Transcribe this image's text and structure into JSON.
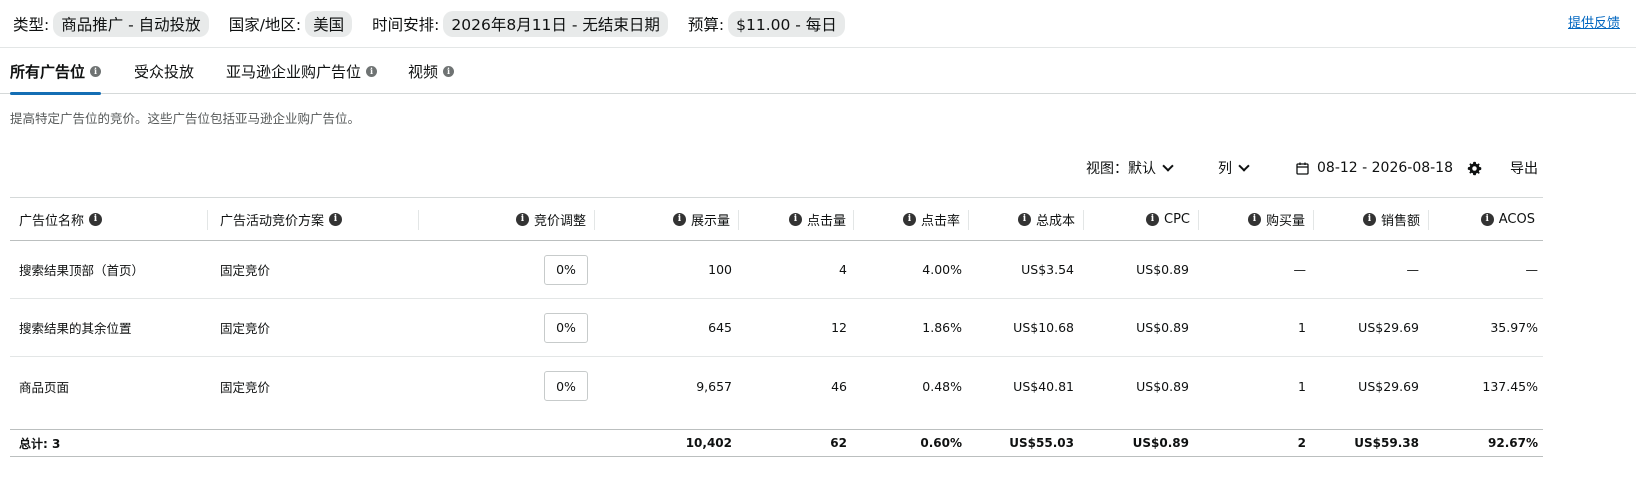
{
  "summary": {
    "type_label": "类型:",
    "type_value": "商品推广 - 自动投放",
    "country_label": "国家/地区:",
    "country_value": "美国",
    "schedule_label": "时间安排:",
    "schedule_value": "2026年8月11日 - 无结束日期",
    "budget_label": "预算:",
    "budget_value": "$11.00 - 每日",
    "feedback_link": "提供反馈"
  },
  "tabs": [
    {
      "label": "所有广告位",
      "active": true,
      "info": true
    },
    {
      "label": "受众投放",
      "active": false,
      "info": false
    },
    {
      "label": "亚马逊企业购广告位",
      "active": false,
      "info": true
    },
    {
      "label": "视频",
      "active": false,
      "info": true
    }
  ],
  "description": "提高特定广告位的竞价。这些广告位包括亚马逊企业购广告位。",
  "toolbar": {
    "view_label": "视图：默认",
    "columns_label": "列",
    "date_range": "08-12 - 2026-08-18",
    "export_label": "导出",
    "calendar_icon": "calendar-icon",
    "settings_icon": "gear-icon"
  },
  "table": {
    "headers": [
      "广告位名称",
      "广告活动竞价方案",
      "竞价调整",
      "展示量",
      "点击量",
      "点击率",
      "总成本",
      "CPC",
      "购买量",
      "销售额",
      "ACOS"
    ],
    "rows": [
      {
        "name": "搜索结果顶部（首页）",
        "strategy": "固定竞价",
        "bid": "0%",
        "impressions": "100",
        "clicks": "4",
        "ctr": "4.00%",
        "cost": "US$3.54",
        "cpc": "US$0.89",
        "purchases": "—",
        "sales": "—",
        "acos": "—"
      },
      {
        "name": "搜索结果的其余位置",
        "strategy": "固定竞价",
        "bid": "0%",
        "impressions": "645",
        "clicks": "12",
        "ctr": "1.86%",
        "cost": "US$10.68",
        "cpc": "US$0.89",
        "purchases": "1",
        "sales": "US$29.69",
        "acos": "35.97%"
      },
      {
        "name": "商品页面",
        "strategy": "固定竞价",
        "bid": "0%",
        "impressions": "9,657",
        "clicks": "46",
        "ctr": "0.48%",
        "cost": "US$40.81",
        "cpc": "US$0.89",
        "purchases": "1",
        "sales": "US$29.69",
        "acos": "137.45%"
      }
    ],
    "total": {
      "label": "总计: 3",
      "impressions": "10,402",
      "clicks": "62",
      "ctr": "0.60%",
      "cost": "US$55.03",
      "cpc": "US$0.89",
      "purchases": "2",
      "sales": "US$59.38",
      "acos": "92.67%"
    }
  },
  "colors": {
    "accent": "#146eb4",
    "link": "#0066c0"
  }
}
